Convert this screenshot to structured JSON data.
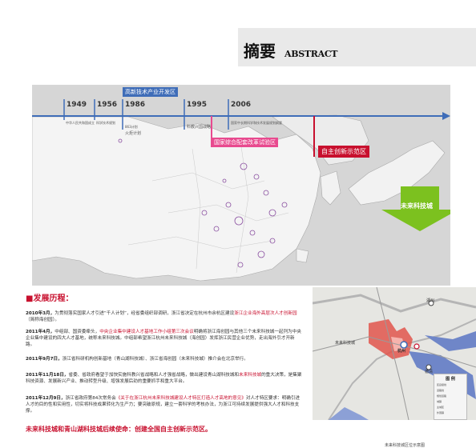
{
  "header": {
    "title_cn": "摘要",
    "title_en": "ABSTRACT"
  },
  "timeline": {
    "years": [
      "1949",
      "1956",
      "1986",
      "1995",
      "2006"
    ],
    "era_label": "高新技术产业开发区",
    "entries": [
      "中华人民共和国成立",
      "科学技术规划",
      "863计划",
      "火炬计划",
      "科教兴国战略",
      "国家中长期科学和技术发展规划纲要"
    ],
    "zones": [
      {
        "label": "国家综合配套改革试验区"
      },
      {
        "label": "自主创新示范区"
      }
    ],
    "arrow_label": "未来科技城"
  },
  "history": {
    "heading": "■发展历程：",
    "paragraphs": [
      {
        "date": "2010年3月，",
        "text": "为贯彻落实国家人才引进“千人计划”，经省委组织部调研，浙江省决定在杭州市余杭区建设",
        "highlight": "浙江企业海外高层次人才创新园",
        "tail": "（简称海创园）。"
      },
      {
        "date": "2011年4月，",
        "text": "中组部、国资委牵头，",
        "highlight": "中央企业集中建设人才基地工作小组第三次会议",
        "tail": "明确将浙江海创园与其他三个未来科技城一起列为中央企业集中建设的四大人才基地，统称未来科技城。中组部希望浙江杭州未来科技城（海创园）发挥浙江民营企业优势，走出海外引才开新路。"
      },
      {
        "date": "2011年9月7日，",
        "text": "浙江省科研机构创新基地（青山湖科技城）、浙江省海创园（未来科技城）推介会在北京举行。",
        "highlight": "",
        "tail": ""
      },
      {
        "date": "2011年11月18日，",
        "text": "省委、省政府看望于加快实施科教兴省战略和人才强省战略，做出建设青山湖科技城和",
        "highlight": "未来科技城",
        "tail": "的重大决策，是集聚科技资源、发展新兴产业、推动转型升级、增强发展后劲的重要抓手和重大平台。"
      },
      {
        "date": "2011年12月9日，",
        "text": "浙江省政府第84次常务会",
        "highlight": "《关于在浙江杭州未来科技城建设人才特区打造人才高地的意见》",
        "tail": "对人才特区要求：明确引进人才的目的性和实用性，切实将科技成果转化为生产力；要突破原规，建立一套科学的考核办法，为浙江可持续发展提供强大人才和科技支撑。"
      }
    ],
    "mission": "未来科技城和青山湖科技城后续使命：创建全国自主创新示范区。"
  },
  "small_map": {
    "labels": [
      "未来科技城",
      "杭州",
      "德清",
      "湖州"
    ],
    "legend_title": "图 例",
    "legend_items": [
      "区县级线",
      "道路线",
      "规划道路",
      "城镇",
      "主城区",
      "外围镇"
    ]
  },
  "caption": "未来科技城区位示意图",
  "colors": {
    "accent": "#c8102e",
    "timeline_blue": "#3f6db8",
    "arrow_green": "#7cc11f",
    "zone_pink": "#e84a8f"
  }
}
